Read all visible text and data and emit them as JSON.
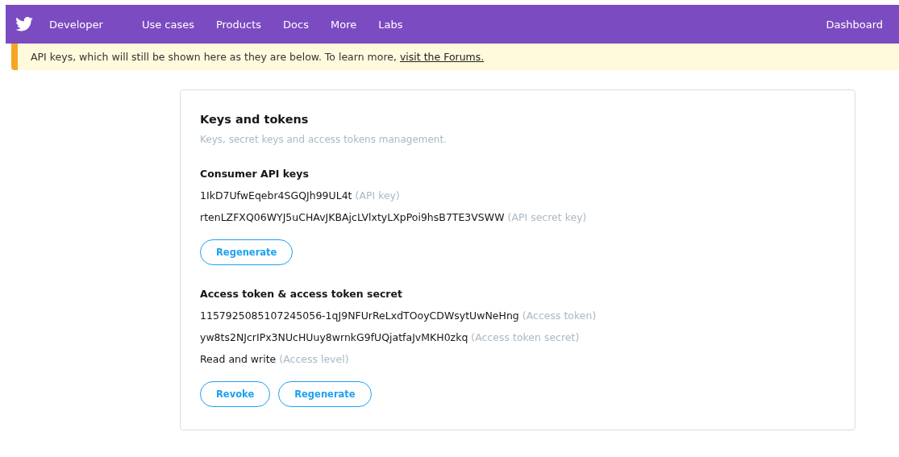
{
  "nav": {
    "brand": "Developer",
    "links": [
      "Use cases",
      "Products",
      "Docs",
      "More",
      "Labs"
    ],
    "right": "Dashboard"
  },
  "banner": {
    "text": "API keys, which will still be shown here as they are below. To learn more, ",
    "link": "visit the Forums."
  },
  "card": {
    "title": "Keys and tokens",
    "subtitle": "Keys, secret keys and access tokens management.",
    "sections": [
      {
        "heading": "Consumer API keys",
        "items": [
          {
            "value": "1IkD7UfwEqebr4SGQJh99UL4t",
            "hint": "(API key)"
          },
          {
            "value": "rtenLZFXQ06WYJ5uCHAvJKBAjcLVlxtyLXpPoi9hsB7TE3VSWW",
            "hint": "(API secret key)"
          }
        ],
        "buttons": [
          "Regenerate"
        ]
      },
      {
        "heading": "Access token & access token secret",
        "items": [
          {
            "value": "1157925085107245056-1qJ9NFUrReLxdTOoyCDWsytUwNeHng",
            "hint": "(Access token)"
          },
          {
            "value": "yw8ts2NJcrIPx3NUcHUuy8wrnkG9fUQjatfaJvMKH0zkq",
            "hint": "(Access token secret)"
          },
          {
            "value": "Read and write",
            "hint": "(Access level)"
          }
        ],
        "buttons": [
          "Revoke",
          "Regenerate"
        ]
      }
    ]
  }
}
